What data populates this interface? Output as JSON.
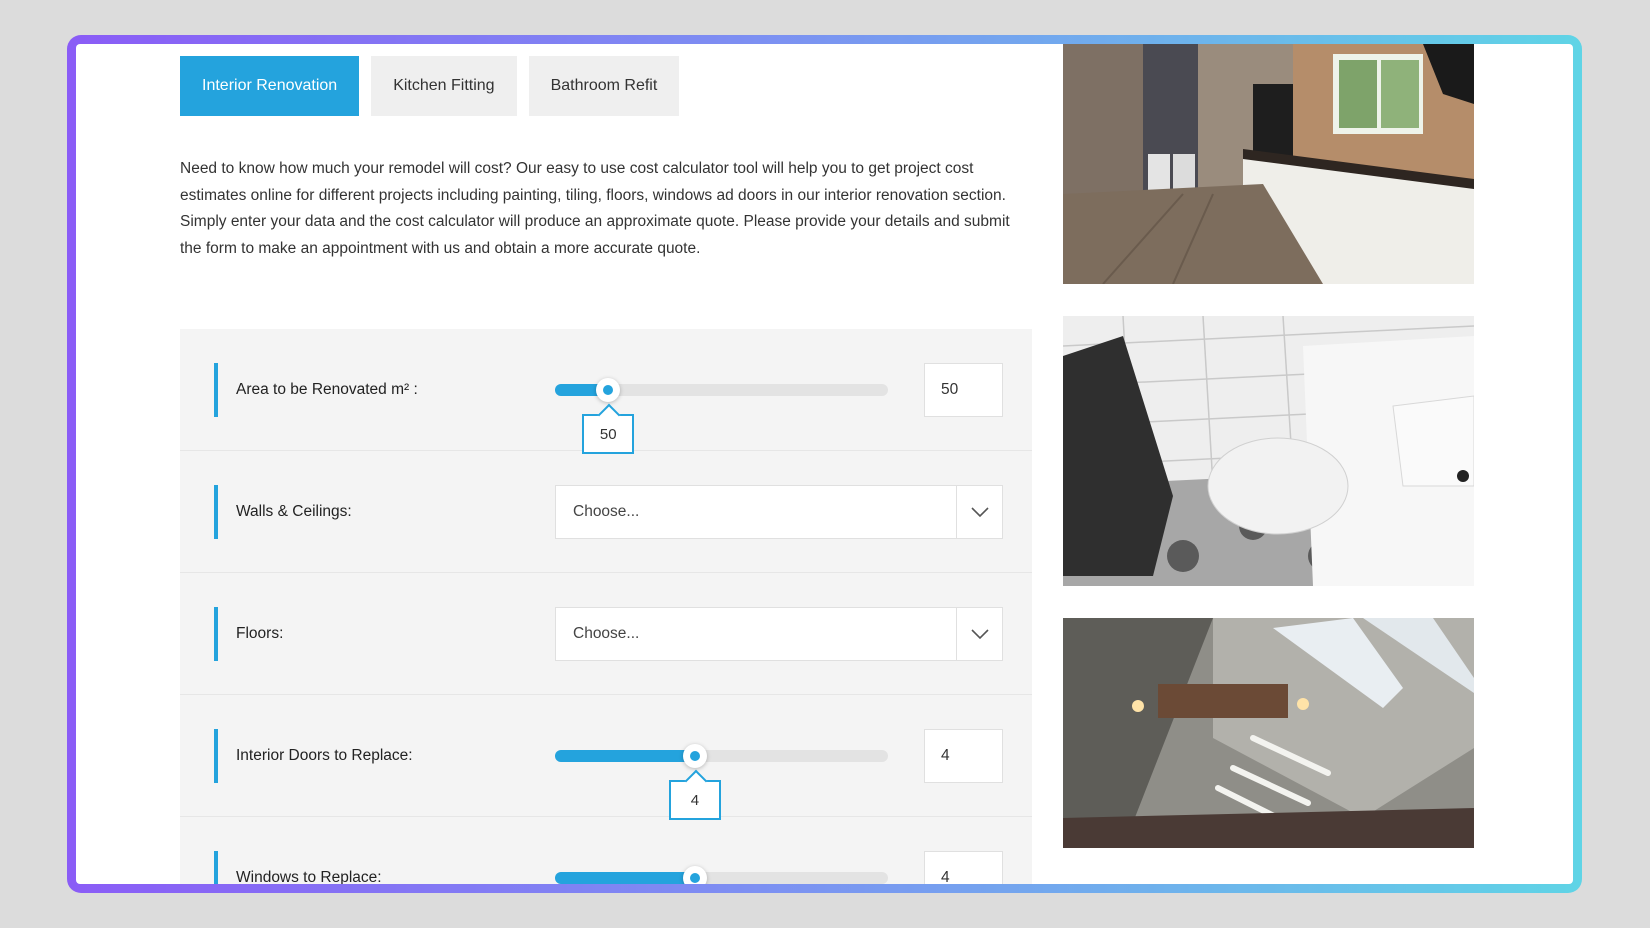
{
  "tabs": [
    {
      "label": "Interior Renovation",
      "active": true
    },
    {
      "label": "Kitchen Fitting",
      "active": false
    },
    {
      "label": "Bathroom Refit",
      "active": false
    }
  ],
  "intro": "Need to know how much your remodel will cost? Our easy to use cost calculator tool will help you to get project cost estimates online for different projects including painting, tiling, floors, windows ad doors in our interior renovation section. Simply enter your data and the cost calculator will produce an approximate quote. Please provide your details and submit the form to make an appointment with us and obtain a more accurate quote.",
  "calculator": {
    "area": {
      "label": "Area to be Renovated m² :",
      "value": "50",
      "fill_fraction": 0.16
    },
    "walls": {
      "label": "Walls & Ceilings:",
      "selected": "Choose..."
    },
    "floors": {
      "label": "Floors:",
      "selected": "Choose..."
    },
    "doors": {
      "label": "Interior Doors to Replace:",
      "value": "4",
      "fill_fraction": 0.42
    },
    "windows": {
      "label": "Windows to Replace:",
      "value": "4",
      "fill_fraction": 0.42
    }
  },
  "colors": {
    "accent": "#24a3dd",
    "panel": "#f4f4f4"
  }
}
